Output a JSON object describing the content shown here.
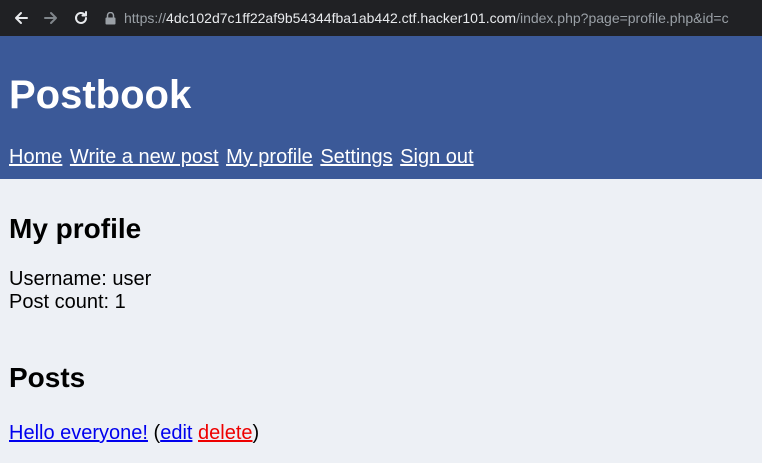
{
  "browser": {
    "url_scheme": "https://",
    "url_host": "4dc102d7c1ff22af9b54344fba1ab442.ctf.hacker101.com",
    "url_path": "/index.php?page=profile.php&id=c"
  },
  "header": {
    "title": "Postbook",
    "nav": [
      "Home",
      "Write a new post",
      "My profile",
      "Settings",
      "Sign out"
    ]
  },
  "profile": {
    "heading": "My profile",
    "username_line": "Username: user",
    "post_count_line": "Post count: 1"
  },
  "posts": {
    "heading": "Posts",
    "items": [
      {
        "title": "Hello everyone!",
        "edit_label": "edit",
        "delete_label": "delete"
      }
    ]
  },
  "colors": {
    "header_bg": "#3b5998",
    "page_bg": "#edf0f5",
    "link": "#0000ee",
    "delete_link": "#ee0000"
  }
}
